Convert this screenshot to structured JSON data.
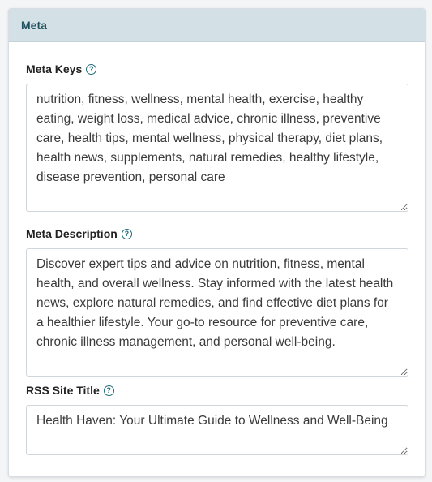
{
  "panel": {
    "title": "Meta"
  },
  "meta_keys": {
    "label": "Meta Keys",
    "value": "nutrition, fitness, wellness, mental health, exercise, healthy eating, weight loss, medical advice, chronic illness, preventive care, health tips, mental wellness, physical therapy, diet plans, health news, supplements, natural remedies, healthy lifestyle, disease prevention, personal care"
  },
  "meta_description": {
    "label": "Meta Description",
    "value": "Discover expert tips and advice on nutrition, fitness, mental health, and overall wellness. Stay informed with the latest health news, explore natural remedies, and find effective diet plans for a healthier lifestyle. Your go-to resource for preventive care, chronic illness management, and personal well-being."
  },
  "rss_site_title": {
    "label": "RSS Site Title",
    "value": "Health Haven: Your Ultimate Guide to Wellness and Well-Being"
  },
  "help_glyph": "?",
  "colors": {
    "header_bg": "#d3e0e6",
    "header_text": "#1f4f5e",
    "help_icon": "#1f6b7a"
  },
  "icons": {
    "help": "question-circle-icon",
    "resize": "resize-grip-icon"
  }
}
